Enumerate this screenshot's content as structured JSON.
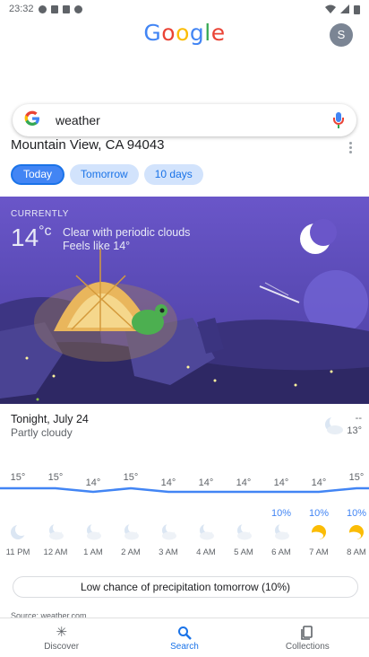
{
  "status_bar": {
    "time": "23:32"
  },
  "header": {
    "logo_letters": [
      {
        "char": "G",
        "color": "#4285f4"
      },
      {
        "char": "o",
        "color": "#ea4335"
      },
      {
        "char": "o",
        "color": "#fbbc05"
      },
      {
        "char": "g",
        "color": "#4285f4"
      },
      {
        "char": "l",
        "color": "#34a853"
      },
      {
        "char": "e",
        "color": "#ea4335"
      }
    ],
    "avatar_initial": "S"
  },
  "search": {
    "value": "weather",
    "icon": "google-g-icon",
    "mic_icon": "mic-icon"
  },
  "location": "Mountain View, CA 94043",
  "tabs": [
    {
      "label": "Today",
      "active": true
    },
    {
      "label": "Tomorrow",
      "active": false
    },
    {
      "label": "10 days",
      "active": false
    }
  ],
  "current": {
    "label": "CURRENTLY",
    "temp": "14",
    "unit": "°c",
    "condition": "Clear with periodic clouds",
    "feels_like": "Feels like 14°"
  },
  "tonight": {
    "title": "Tonight, July 24",
    "condition": "Partly cloudy",
    "high": "--",
    "low": "13°"
  },
  "hourly": [
    {
      "temp": "15°",
      "precip": "",
      "time": "11 PM",
      "icon": "moon-icon"
    },
    {
      "temp": "15°",
      "precip": "",
      "time": "12 AM",
      "icon": "moon-cloud-icon"
    },
    {
      "temp": "14°",
      "precip": "",
      "time": "1 AM",
      "icon": "moon-cloud-icon"
    },
    {
      "temp": "15°",
      "precip": "",
      "time": "2 AM",
      "icon": "moon-cloud-icon"
    },
    {
      "temp": "14°",
      "precip": "",
      "time": "3 AM",
      "icon": "moon-cloud-icon"
    },
    {
      "temp": "14°",
      "precip": "",
      "time": "4 AM",
      "icon": "moon-cloud-icon"
    },
    {
      "temp": "14°",
      "precip": "",
      "time": "5 AM",
      "icon": "moon-cloud-icon"
    },
    {
      "temp": "14°",
      "precip": "10%",
      "time": "6 AM",
      "icon": "moon-cloud-icon"
    },
    {
      "temp": "14°",
      "precip": "10%",
      "time": "7 AM",
      "icon": "sun-cloud-icon"
    },
    {
      "temp": "15°",
      "precip": "10%",
      "time": "8 AM",
      "icon": "sun-cloud-icon"
    }
  ],
  "precip_note": "Low chance of precipitation tomorrow (10%)",
  "source": "Source: weather.com",
  "bottom_nav": [
    {
      "label": "Discover",
      "icon": "asterisk-icon",
      "active": false
    },
    {
      "label": "Search",
      "icon": "search-icon",
      "active": true
    },
    {
      "label": "Collections",
      "icon": "collections-icon",
      "active": false
    }
  ],
  "colors": {
    "accent": "#4285f4",
    "scene_purple": "#5c4cb8",
    "precip_blue": "#4285f4"
  }
}
